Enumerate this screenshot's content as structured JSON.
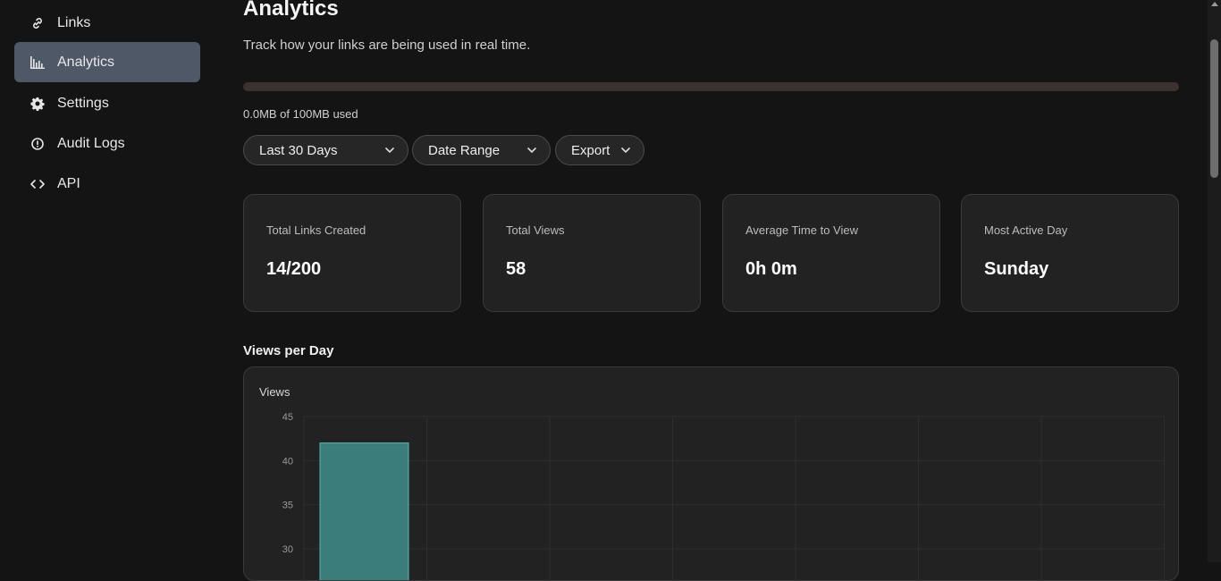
{
  "sidebar": {
    "items": [
      {
        "label": "Links",
        "icon": "link-icon"
      },
      {
        "label": "Analytics",
        "icon": "bar-chart-icon"
      },
      {
        "label": "Settings",
        "icon": "gear-icon"
      },
      {
        "label": "Audit Logs",
        "icon": "info-circle-icon"
      },
      {
        "label": "API",
        "icon": "code-icon"
      }
    ],
    "active": "Analytics"
  },
  "header": {
    "title": "Analytics",
    "subtitle": "Track how your links are being used in real time."
  },
  "usage": {
    "text": "0.0MB of 100MB used",
    "fraction": 0.0
  },
  "filters": {
    "period": "Last 30 Days",
    "date_range": "Date Range",
    "export": "Export"
  },
  "stats": [
    {
      "label": "Total Links Created",
      "value": "14/200"
    },
    {
      "label": "Total Views",
      "value": "58"
    },
    {
      "label": "Average Time to View",
      "value": "0h 0m"
    },
    {
      "label": "Most Active Day",
      "value": "Sunday"
    }
  ],
  "chart_section": {
    "title": "Views per Day"
  },
  "chart_data": {
    "type": "bar",
    "ylabel": "Views",
    "yticks": [
      30,
      35,
      40,
      45
    ],
    "ylim_visible": [
      30,
      45
    ],
    "values": [
      42
    ],
    "bar_color": "#3a7d7a"
  },
  "colors": {
    "accent": "#4f5866",
    "background": "#141414",
    "card": "#222222"
  }
}
